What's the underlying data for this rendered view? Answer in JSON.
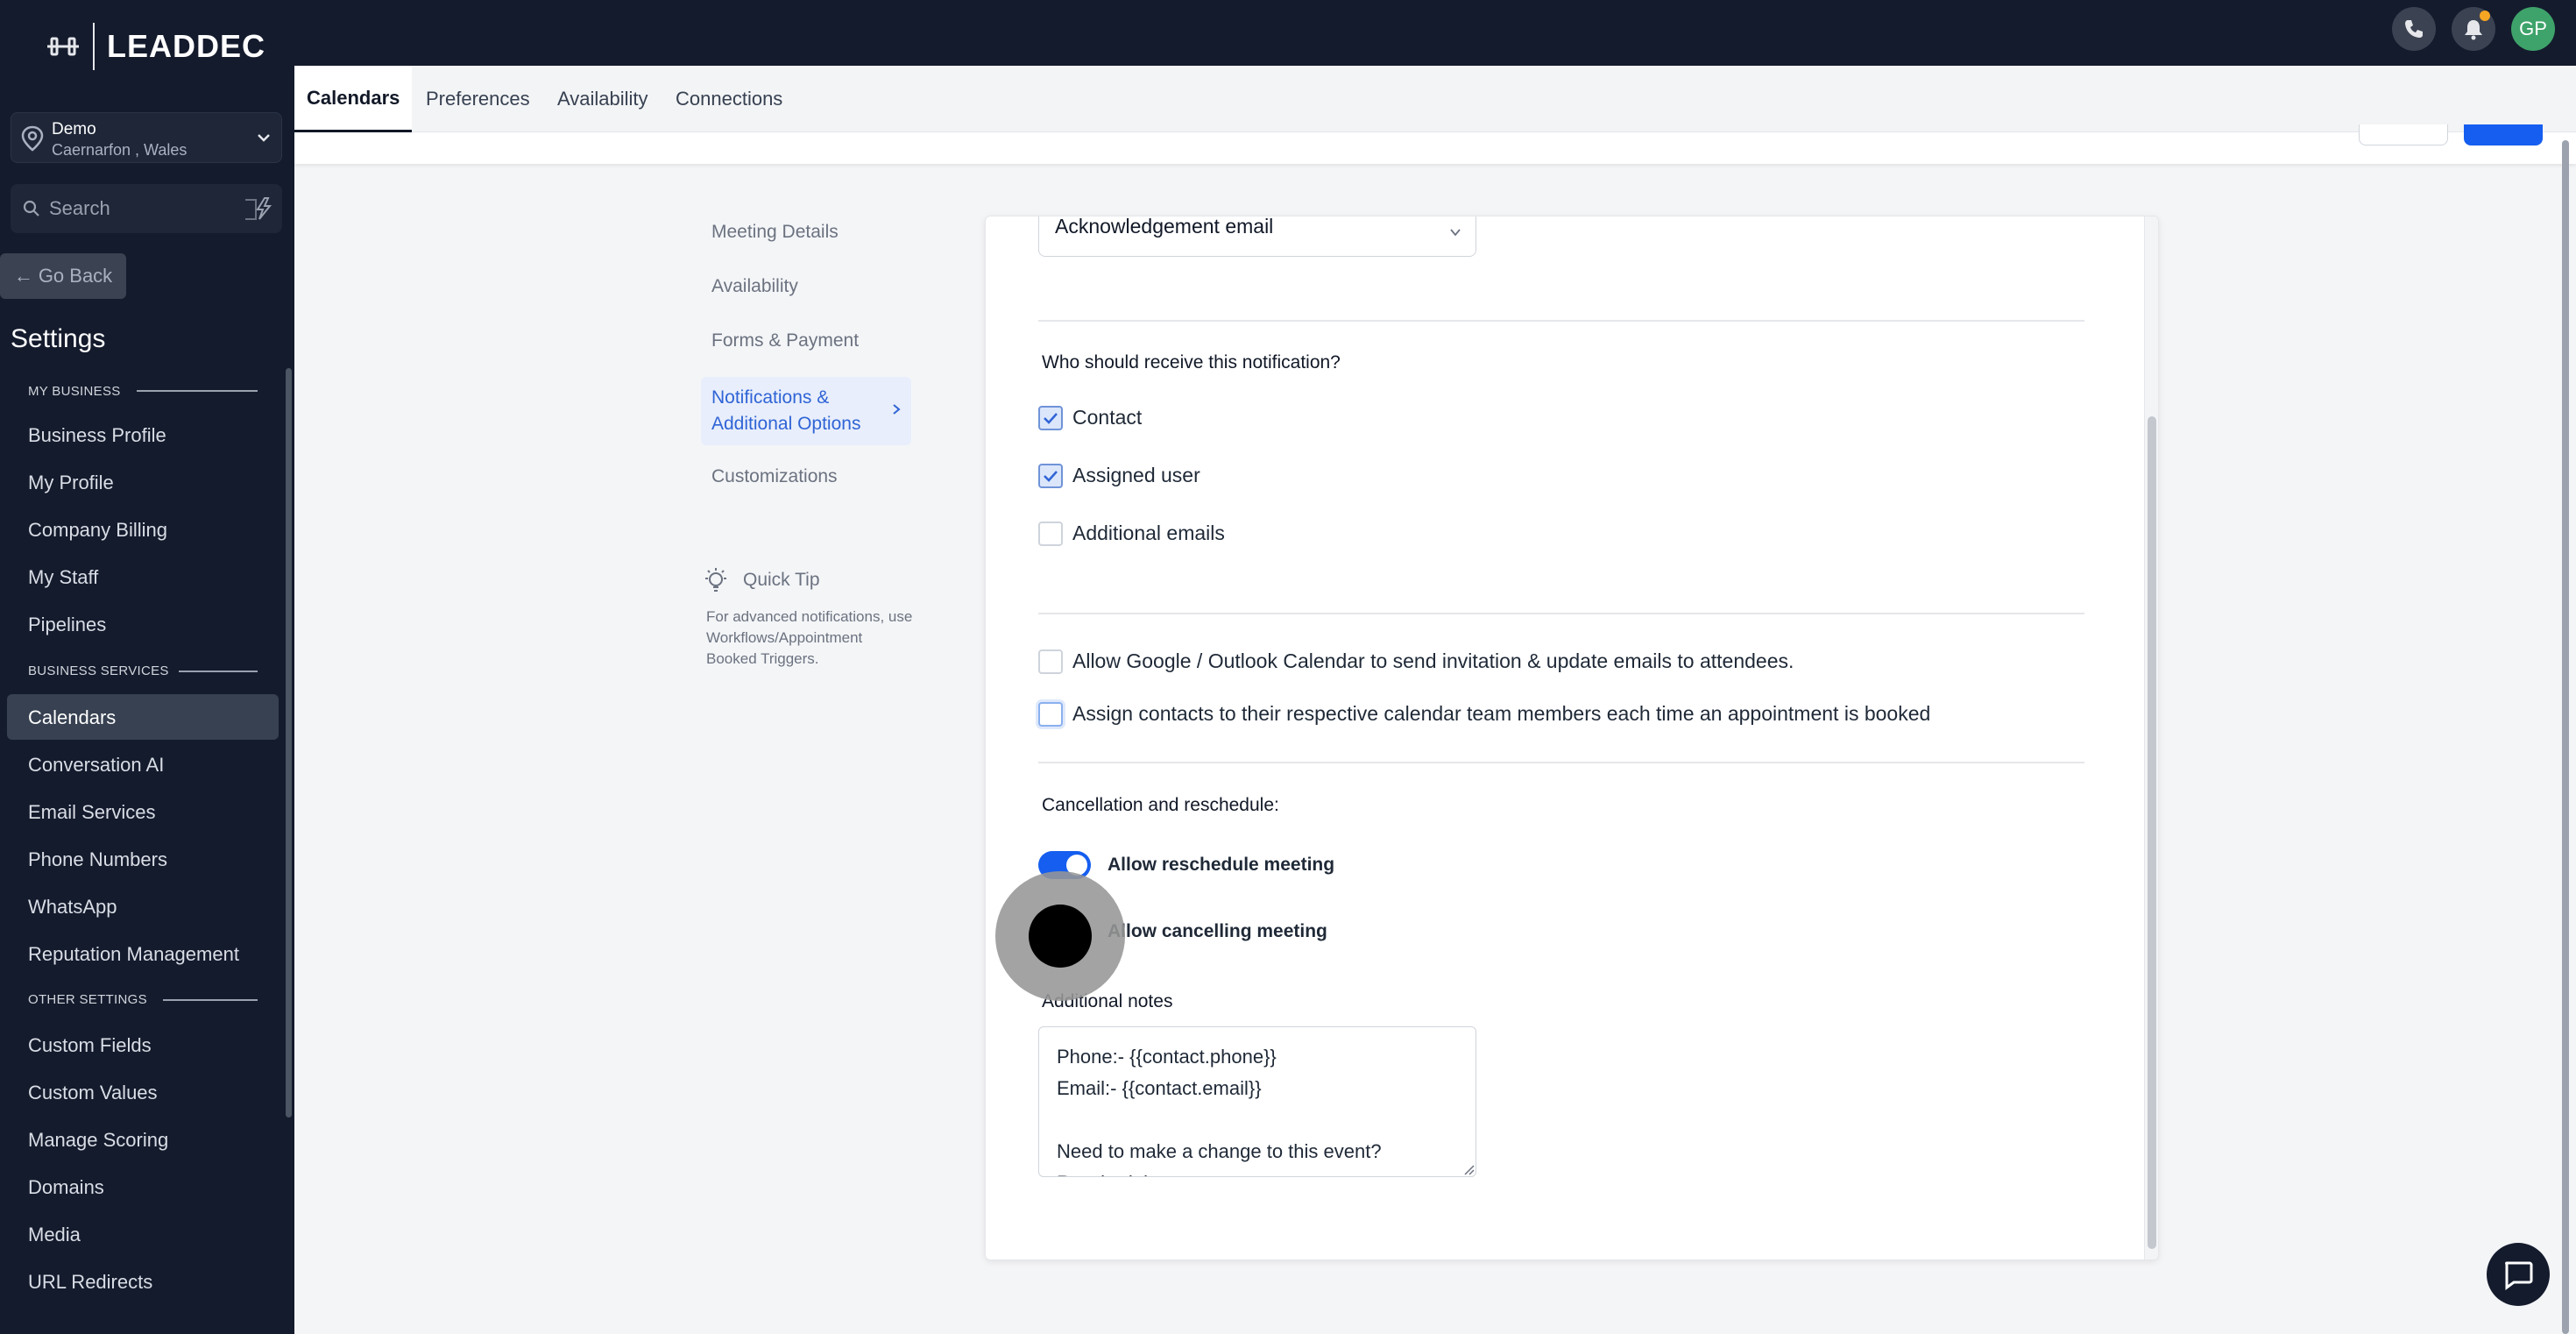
{
  "brand": {
    "name": "LEADDEC"
  },
  "topbar": {
    "avatar_initials": "GP",
    "notification_dot_color": "#f5a623",
    "icons": [
      "phone-icon",
      "bell-icon"
    ]
  },
  "location": {
    "name": "Demo",
    "sub": "Caernarfon , Wales"
  },
  "search": {
    "placeholder": "Search"
  },
  "go_back": {
    "label": "Go Back"
  },
  "settings_title": "Settings",
  "sidebar": {
    "sections": [
      {
        "heading": "MY BUSINESS",
        "items": [
          "Business Profile",
          "My Profile",
          "Company Billing",
          "My Staff",
          "Pipelines"
        ]
      },
      {
        "heading": "BUSINESS SERVICES",
        "items": [
          "Calendars",
          "Conversation AI",
          "Email Services",
          "Phone Numbers",
          "WhatsApp",
          "Reputation Management"
        ]
      },
      {
        "heading": "OTHER SETTINGS",
        "items": [
          "Custom Fields",
          "Custom Values",
          "Manage Scoring",
          "Domains",
          "Media",
          "URL Redirects"
        ]
      }
    ],
    "active_item": "Calendars"
  },
  "tabs": [
    "Calendars",
    "Preferences",
    "Availability",
    "Connections"
  ],
  "active_tab": "Calendars",
  "steps": [
    "Meeting Details",
    "Availability",
    "Forms & Payment",
    "Notifications & Additional Options",
    "Customizations"
  ],
  "active_step": "Notifications & Additional Options",
  "quick_tip": {
    "title": "Quick Tip",
    "body": "For advanced notifications, use Workflows/Appointment Booked Triggers."
  },
  "notification": {
    "template_select": "Acknowledgement email",
    "recipients_question": "Who should receive this notification?",
    "recipients": [
      {
        "label": "Contact",
        "checked": true
      },
      {
        "label": "Assigned user",
        "checked": true
      },
      {
        "label": "Additional emails",
        "checked": false
      }
    ],
    "options": [
      {
        "label": "Allow Google / Outlook Calendar to send invitation & update emails to attendees.",
        "checked": false
      },
      {
        "label": "Assign contacts to their respective calendar team members each time an appointment is booked",
        "checked": false
      }
    ],
    "cancellation_heading": "Cancellation and reschedule:",
    "toggles": [
      {
        "label": "Allow reschedule meeting",
        "on": true
      },
      {
        "label": "Allow cancelling meeting",
        "on": false
      }
    ],
    "notes_label": "Additional notes",
    "notes_value": "Phone:- {{contact.phone}}\nEmail:- {{contact.email}}\n\nNeed to make a change to this event?\nReschedule:"
  },
  "colors": {
    "accent": "#155eef",
    "sidebar_bg": "#141b2d",
    "active_step_text": "#2f64d6"
  }
}
